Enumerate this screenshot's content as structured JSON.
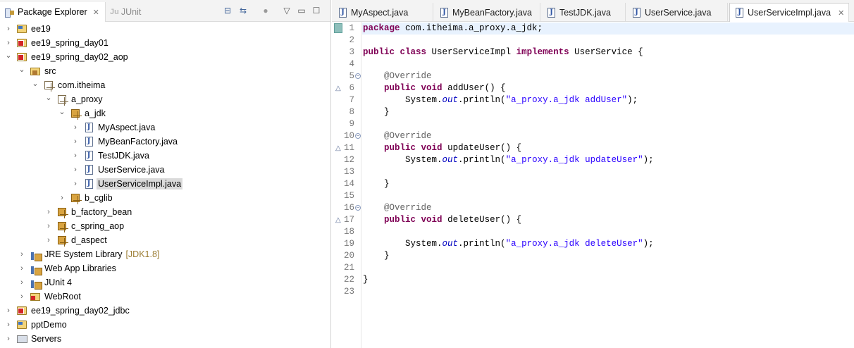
{
  "left_panel": {
    "tabs": [
      {
        "label": "Package Explorer",
        "active": true
      },
      {
        "label": "JUnit",
        "active": false
      }
    ],
    "junit_icon": "Ju",
    "tree": [
      {
        "label": "ee19",
        "depth": 0,
        "expanded": false,
        "icon": "project-icon"
      },
      {
        "label": "ee19_spring_day01",
        "depth": 0,
        "expanded": false,
        "icon": "project-error-icon"
      },
      {
        "label": "ee19_spring_day02_aop",
        "depth": 0,
        "expanded": true,
        "icon": "project-error-icon"
      },
      {
        "label": "src",
        "depth": 1,
        "expanded": true,
        "icon": "source-folder-icon"
      },
      {
        "label": "com.itheima",
        "depth": 2,
        "expanded": true,
        "icon": "empty-package-icon"
      },
      {
        "label": "a_proxy",
        "depth": 3,
        "expanded": true,
        "icon": "empty-package-icon"
      },
      {
        "label": "a_jdk",
        "depth": 4,
        "expanded": true,
        "icon": "package-icon"
      },
      {
        "label": "MyAspect.java",
        "depth": 5,
        "expanded": false,
        "icon": "java-file-icon"
      },
      {
        "label": "MyBeanFactory.java",
        "depth": 5,
        "expanded": false,
        "icon": "java-file-icon"
      },
      {
        "label": "TestJDK.java",
        "depth": 5,
        "expanded": false,
        "icon": "java-file-icon"
      },
      {
        "label": "UserService.java",
        "depth": 5,
        "expanded": false,
        "icon": "java-interface-icon"
      },
      {
        "label": "UserServiceImpl.java",
        "depth": 5,
        "expanded": false,
        "icon": "java-file-icon",
        "selected": true
      },
      {
        "label": "b_cglib",
        "depth": 4,
        "expanded": false,
        "icon": "package-icon"
      },
      {
        "label": "b_factory_bean",
        "depth": 3,
        "expanded": false,
        "icon": "package-icon"
      },
      {
        "label": "c_spring_aop",
        "depth": 3,
        "expanded": false,
        "icon": "package-icon"
      },
      {
        "label": "d_aspect",
        "depth": 3,
        "expanded": false,
        "icon": "package-icon"
      },
      {
        "label": "JRE System Library",
        "decoration": "[JDK1.8]",
        "depth": 1,
        "expanded": false,
        "icon": "library-icon"
      },
      {
        "label": "Web App Libraries",
        "depth": 1,
        "expanded": false,
        "icon": "library-icon"
      },
      {
        "label": "JUnit 4",
        "depth": 1,
        "expanded": false,
        "icon": "library-icon"
      },
      {
        "label": "WebRoot",
        "depth": 1,
        "expanded": false,
        "icon": "webroot-folder-icon"
      },
      {
        "label": "ee19_spring_day02_jdbc",
        "depth": 0,
        "expanded": false,
        "icon": "project-error-icon"
      },
      {
        "label": "pptDemo",
        "depth": 0,
        "expanded": false,
        "icon": "project-icon"
      },
      {
        "label": "Servers",
        "depth": 0,
        "expanded": false,
        "icon": "servers-folder-icon"
      }
    ]
  },
  "editor": {
    "tabs": [
      {
        "label": "MyAspect.java",
        "active": false
      },
      {
        "label": "MyBeanFactory.java",
        "active": false
      },
      {
        "label": "TestJDK.java",
        "active": false
      },
      {
        "label": "UserService.java",
        "active": false
      },
      {
        "label": "UserServiceImpl.java",
        "active": true
      }
    ],
    "current_line": 1,
    "lines": [
      "package com.itheima.a_proxy.a_jdk;",
      "",
      "public class UserServiceImpl implements UserService {",
      "",
      "    @Override",
      "    public void addUser() {",
      "        System.out.println(\"a_proxy.a_jdk addUser\");",
      "    }",
      "",
      "    @Override",
      "    public void updateUser() {",
      "        System.out.println(\"a_proxy.a_jdk updateUser\");",
      "",
      "    }",
      "",
      "    @Override",
      "    public void deleteUser() {",
      "",
      "        System.out.println(\"a_proxy.a_jdk deleteUser\");",
      "    }",
      "",
      "}",
      ""
    ],
    "fold_lines": [
      5,
      10,
      16
    ],
    "override_marker_lines": [
      6,
      11,
      17
    ]
  }
}
